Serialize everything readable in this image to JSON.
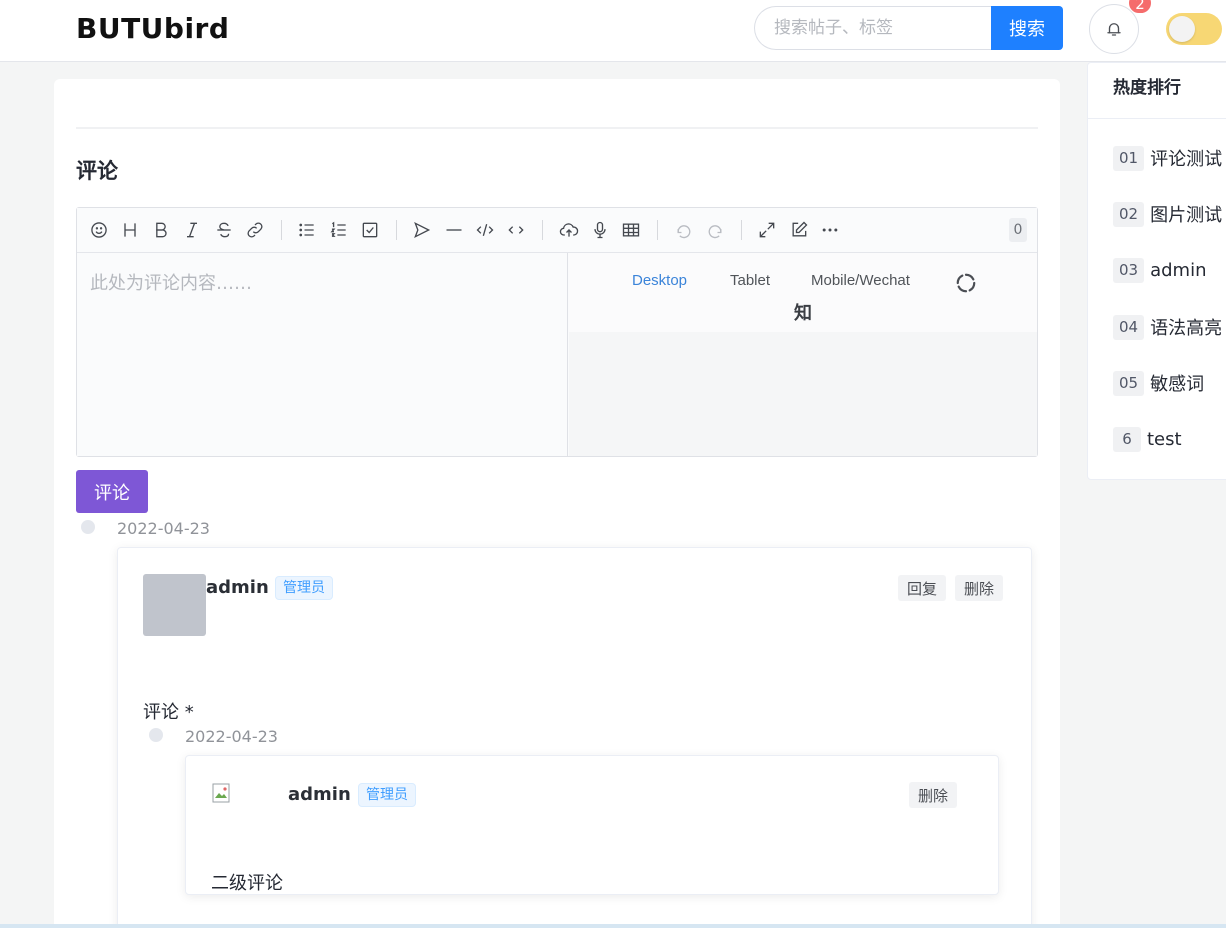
{
  "header": {
    "logo": "BUTUbird",
    "search_placeholder": "搜索帖子、标签",
    "search_button": "搜索",
    "notification_count": "2"
  },
  "main": {
    "section_title": "评论",
    "editor": {
      "placeholder": "此处为评论内容……",
      "char_count": "0",
      "preview_tabs": [
        "Desktop",
        "Tablet",
        "Mobile/Wechat"
      ],
      "preview_active": "Desktop",
      "preview_theme": "知"
    },
    "submit_button": "评论",
    "comments": [
      {
        "date": "2022-04-23",
        "username": "admin",
        "role": "管理员",
        "actions": [
          "回复",
          "删除"
        ],
        "content": "评论 *",
        "replies": [
          {
            "date": "2022-04-23",
            "username": "admin",
            "role": "管理员",
            "actions": [
              "删除"
            ],
            "content": "二级评论"
          }
        ]
      }
    ]
  },
  "sidebar": {
    "title": "热度排行",
    "items": [
      {
        "rank": "01",
        "title": "评论测试"
      },
      {
        "rank": "02",
        "title": "图片测试"
      },
      {
        "rank": "03",
        "title": "admin"
      },
      {
        "rank": "04",
        "title": "语法高亮"
      },
      {
        "rank": "05",
        "title": "敏感词"
      },
      {
        "rank": "6",
        "title": "test"
      }
    ]
  },
  "colors": {
    "accent_blue": "#1e80ff",
    "submit_purple": "#7e57d6",
    "tag_blue": "#409eff",
    "badge_red": "#f56c6c",
    "toggle_yellow": "#f7d774"
  }
}
